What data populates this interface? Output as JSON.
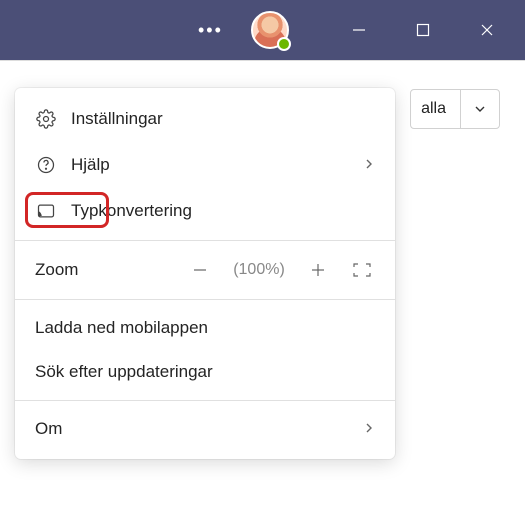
{
  "titlebar": {
    "more_label": "•••"
  },
  "right_control": {
    "label": "alla"
  },
  "menu": {
    "settings": "Inställningar",
    "help": "Hjälp",
    "cast": "Typkonvertering",
    "zoom_label": "Zoom",
    "zoom_value": "(100%)",
    "download_app": "Ladda ned mobilappen",
    "check_updates": "Sök efter uppdateringar",
    "about": "Om"
  }
}
